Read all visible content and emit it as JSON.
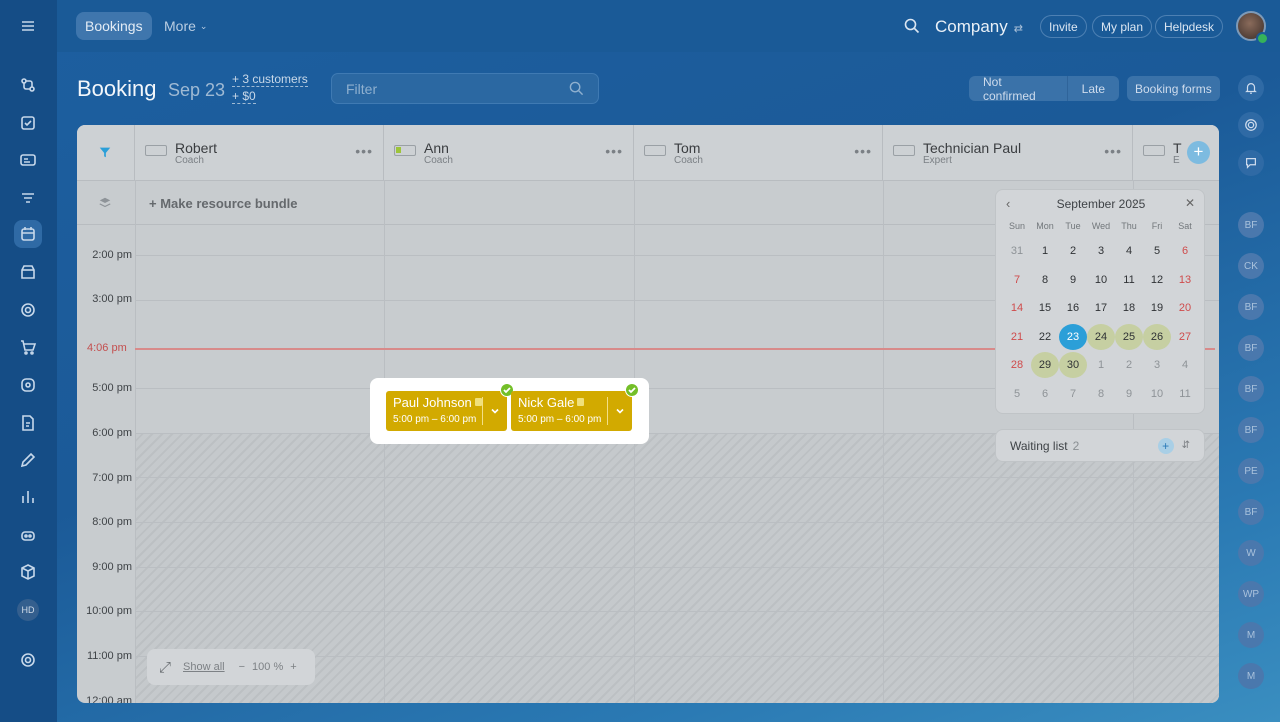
{
  "header": {
    "nav_active": "Bookings",
    "nav_more": "More",
    "company": "Company",
    "invite": "Invite",
    "my_plan": "My plan",
    "helpdesk": "Helpdesk"
  },
  "page": {
    "title": "Booking",
    "date": "Sep 23",
    "customers": "+ 3 customers",
    "amount": "+ $0",
    "filter_placeholder": "Filter",
    "not_confirmed": "Not confirmed",
    "late": "Late",
    "booking_forms": "Booking forms"
  },
  "resources": [
    {
      "name": "Robert",
      "role": "Coach"
    },
    {
      "name": "Ann",
      "role": "Coach"
    },
    {
      "name": "Tom",
      "role": "Coach"
    },
    {
      "name": "Technician Paul",
      "role": "Expert"
    },
    {
      "name": "T",
      "role": "E"
    }
  ],
  "bundle_label": "+ Make resource bundle",
  "times": [
    "2:00 pm",
    "3:00 pm",
    "5:00 pm",
    "6:00 pm",
    "7:00 pm",
    "8:00 pm",
    "9:00 pm",
    "10:00 pm",
    "11:00 pm",
    "12:00 am"
  ],
  "now_label": "4:06 pm",
  "bookings": [
    {
      "name": "Paul Johnson",
      "time": "5:00 pm – 6:00 pm"
    },
    {
      "name": "Nick Gale",
      "time": "5:00 pm – 6:00 pm"
    }
  ],
  "calendar": {
    "month": "September 2025",
    "dow": [
      "Sun",
      "Mon",
      "Tue",
      "Wed",
      "Thu",
      "Fri",
      "Sat"
    ],
    "weeks": [
      [
        "31",
        "1",
        "2",
        "3",
        "4",
        "5",
        "6"
      ],
      [
        "7",
        "8",
        "9",
        "10",
        "11",
        "12",
        "13"
      ],
      [
        "14",
        "15",
        "16",
        "17",
        "18",
        "19",
        "20"
      ],
      [
        "21",
        "22",
        "23",
        "24",
        "25",
        "26",
        "27"
      ],
      [
        "28",
        "29",
        "30",
        "1",
        "2",
        "3",
        "4"
      ],
      [
        "5",
        "6",
        "7",
        "8",
        "9",
        "10",
        "11"
      ]
    ],
    "selected": "23",
    "highlighted": [
      "24",
      "25",
      "26",
      "29",
      "30"
    ]
  },
  "waiting_list": {
    "label": "Waiting list",
    "count": "2"
  },
  "zoom": {
    "show_all": "Show all",
    "minus": "−",
    "value": "100 %",
    "plus": "+"
  },
  "sidebar_user_initials": "HD",
  "right_avatars": [
    "BF",
    "CK",
    "BF",
    "BF",
    "BF",
    "BF",
    "PE",
    "BF",
    "W",
    "WP",
    "M",
    "M"
  ],
  "colors": {
    "booking": "#d2aa00",
    "selected_day": "#2b9fd8",
    "check": "#74bf28",
    "now_line": "#d88a8a"
  }
}
